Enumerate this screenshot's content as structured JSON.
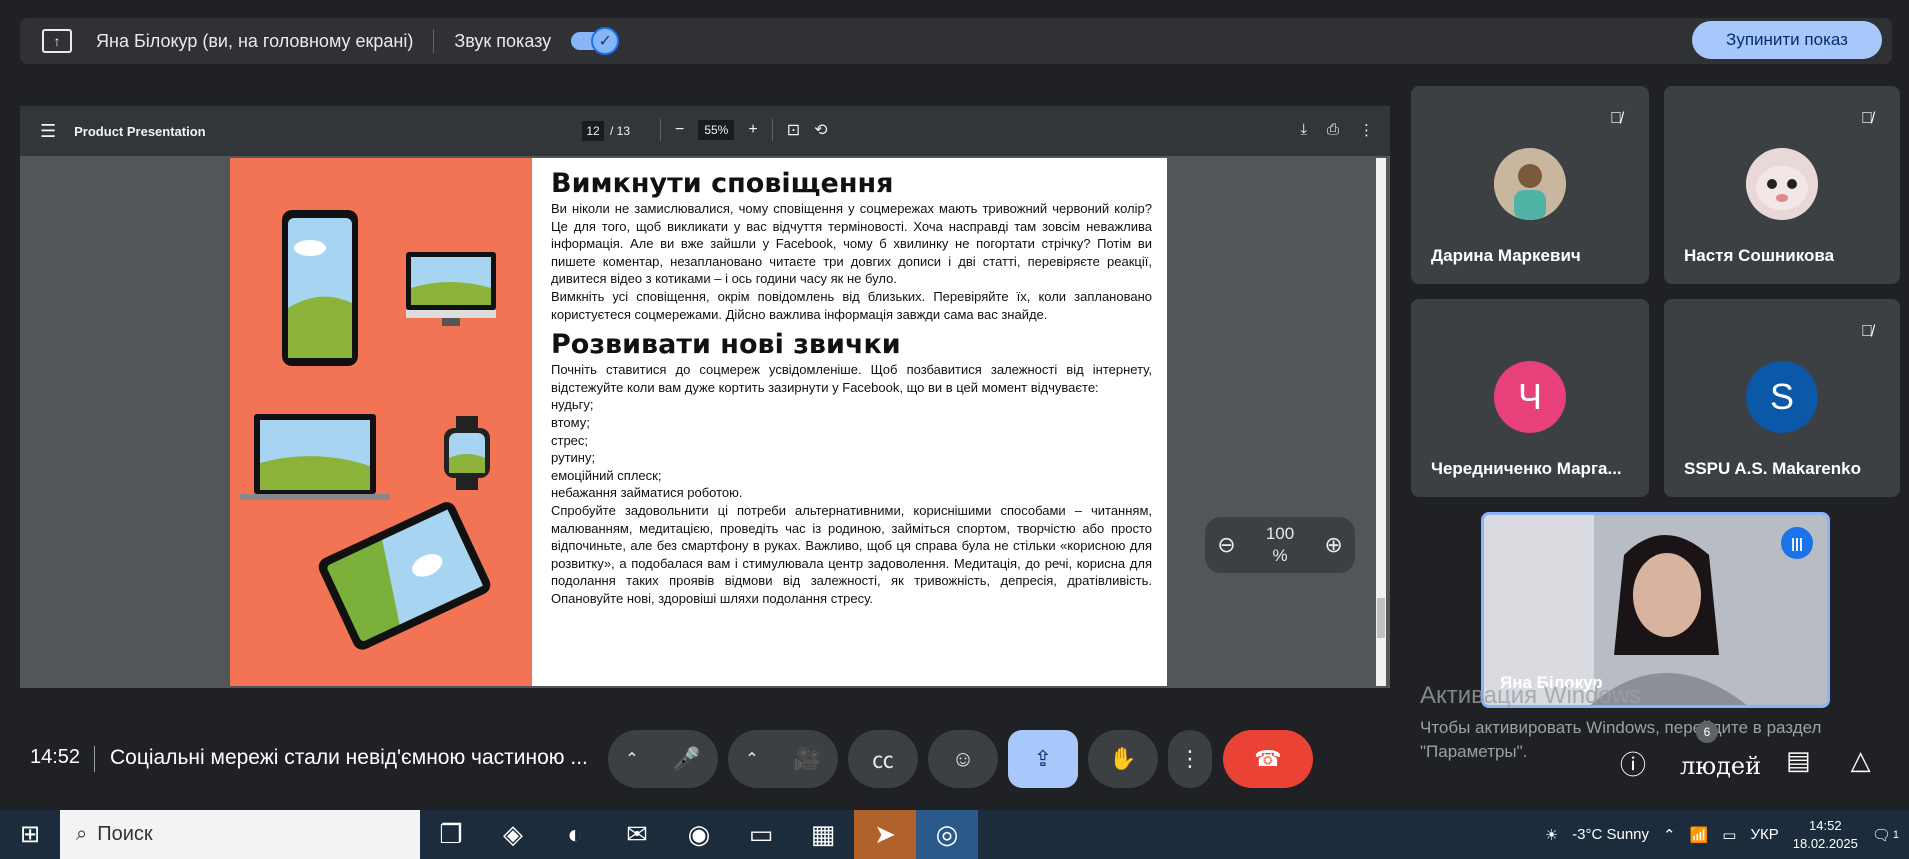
{
  "topbar": {
    "presenter": "Яна Білокур (ви, на головному екрані)",
    "sound_label": "Звук показу",
    "stop_label": "Зупинити показ"
  },
  "pdf": {
    "title": "Product Presentation",
    "page_current": "12",
    "page_total": "/ 13",
    "zoom": "55%",
    "float_zoom": "100 %",
    "heading1": "Вимкнути сповіщення",
    "para1": "Ви ніколи не замислювалися, чому сповіщення у соцмережах мають тривожний червоний колір? Це для того, щоб викликати у вас відчуття терміновості. Хоча насправді там зовсім неважлива інформація. Але ви вже зайшли у Facebook, чому б хвилинку не погортати стрічку? Потім ви пишете коментар, незаплановано читаєте три довгих дописи і дві статті, перевіряєте реакції, дивитеся відео з котиками – і ось години часу як не було.",
    "para2": "Вимкніть усі сповіщення, окрім повідомлень від близьких. Перевіряйте їх, коли заплановано користуєтеся соцмережами. Дійсно важлива інформація завжди сама вас знайде.",
    "heading2": "Розвивати нові звички",
    "para3": "Почніть ставитися до соцмереж усвідомленіше. Щоб позбавитися залежності від інтернету, відстежуйте коли вам дуже кортить зазирнути у Facebook, що ви в цей момент відчуваєте:",
    "list": [
      "нудьгу;",
      "втому;",
      "стрес;",
      "рутину;",
      "емоційний сплеск;",
      "небажання займатися роботою."
    ],
    "para4": "Спробуйте задовольнити ці потреби альтернативними, кориснішими способами – читанням, малюванням, медитацією, проведіть час із родиною, займіться спортом, творчістю або просто відпочиньте, але без смартфону в руках. Важливо, щоб ця справа була не стільки «корисною для розвитку», а подобалася вам і стимулювала центр задоволення. Медитація, до речі, корисна для подолання таких проявів відмови від залежності, як тривожність, депресія, дратівливість. Опановуйте нові, здоровіші шляхи подолання стресу."
  },
  "participants": [
    {
      "name": "Дарина Маркевич",
      "initial": "",
      "color": "#8d6e63"
    },
    {
      "name": "Настя Сошникова",
      "initial": "",
      "color": "#d7a9a9"
    },
    {
      "name": "Чередниченко Марга...",
      "initial": "Ч",
      "color": "#e8407a"
    },
    {
      "name": "SSPU A.S. Makarenko",
      "initial": "S",
      "color": "#0b57a8"
    }
  ],
  "self": {
    "name": "Яна Білокур"
  },
  "activation": {
    "title": "Активация Windows",
    "line1": "Чтобы активировать Windows, перейдите в раздел",
    "line2": "\"Параметры\"."
  },
  "callbar": {
    "time": "14:52",
    "meeting": "Соціальні мережі стали невід'ємною частиною ...",
    "people_label": "людей",
    "people_count": "6"
  },
  "taskbar": {
    "search": "Поиск",
    "weather": "-3°C  Sunny",
    "lang": "УКР",
    "time": "14:52",
    "date": "18.02.2025",
    "notifications": "1"
  }
}
